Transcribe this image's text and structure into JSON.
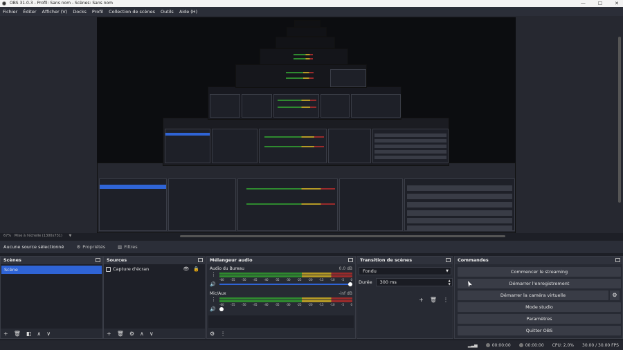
{
  "window": {
    "title": "OBS 31.0.3 - Profil: Sans nom - Scènes: Sans nom",
    "min": "—",
    "max": "☐",
    "close": "✕"
  },
  "menu": [
    "Fichier",
    "Éditer",
    "Afficher (V)",
    "Docks",
    "Profil",
    "Collection de scènes",
    "Outils",
    "Aide (H)"
  ],
  "status": {
    "zoom": "67%",
    "scale": "Mise à l'échelle (1300x731)"
  },
  "props_bar": {
    "no_source": "Aucune source sélectionné",
    "properties": "Propriétés",
    "filters": "Filtres"
  },
  "scenes": {
    "title": "Scènes",
    "items": [
      "Scène"
    ]
  },
  "sources": {
    "title": "Sources",
    "items": [
      "Capture d'écran"
    ]
  },
  "mixer": {
    "title": "Mélangeur audio",
    "channels": [
      {
        "name": "Audio du Bureau",
        "db": "0.0 dB",
        "level": 1.0
      },
      {
        "name": "Mic/Aux",
        "db": "-inf dB",
        "level": 0.0
      }
    ],
    "ticks": [
      "-60",
      "-55",
      "-50",
      "-45",
      "-40",
      "-35",
      "-30",
      "-25",
      "-20",
      "-15",
      "-10",
      "-5",
      "0"
    ]
  },
  "transition": {
    "title": "Transition de scènes",
    "type": "Fondu",
    "duration_label": "Durée",
    "duration": "300 ms"
  },
  "commands": {
    "title": "Commandes",
    "stream": "Commencer le streaming",
    "record": "Démarrer l'enregistrement",
    "virtualcam": "Démarrer la caméra virtuelle",
    "studio": "Mode studio",
    "settings": "Paramètres",
    "quit": "Quitter OBS"
  },
  "statusbar": {
    "stream_time": "00:00:00",
    "rec_time": "00:00:00",
    "cpu": "CPU: 2.0%",
    "fps": "30.00 / 30.00 FPS"
  },
  "colors": {
    "accent": "#2f64d6",
    "bg": "#1d1f26",
    "panel": "#272a33"
  }
}
